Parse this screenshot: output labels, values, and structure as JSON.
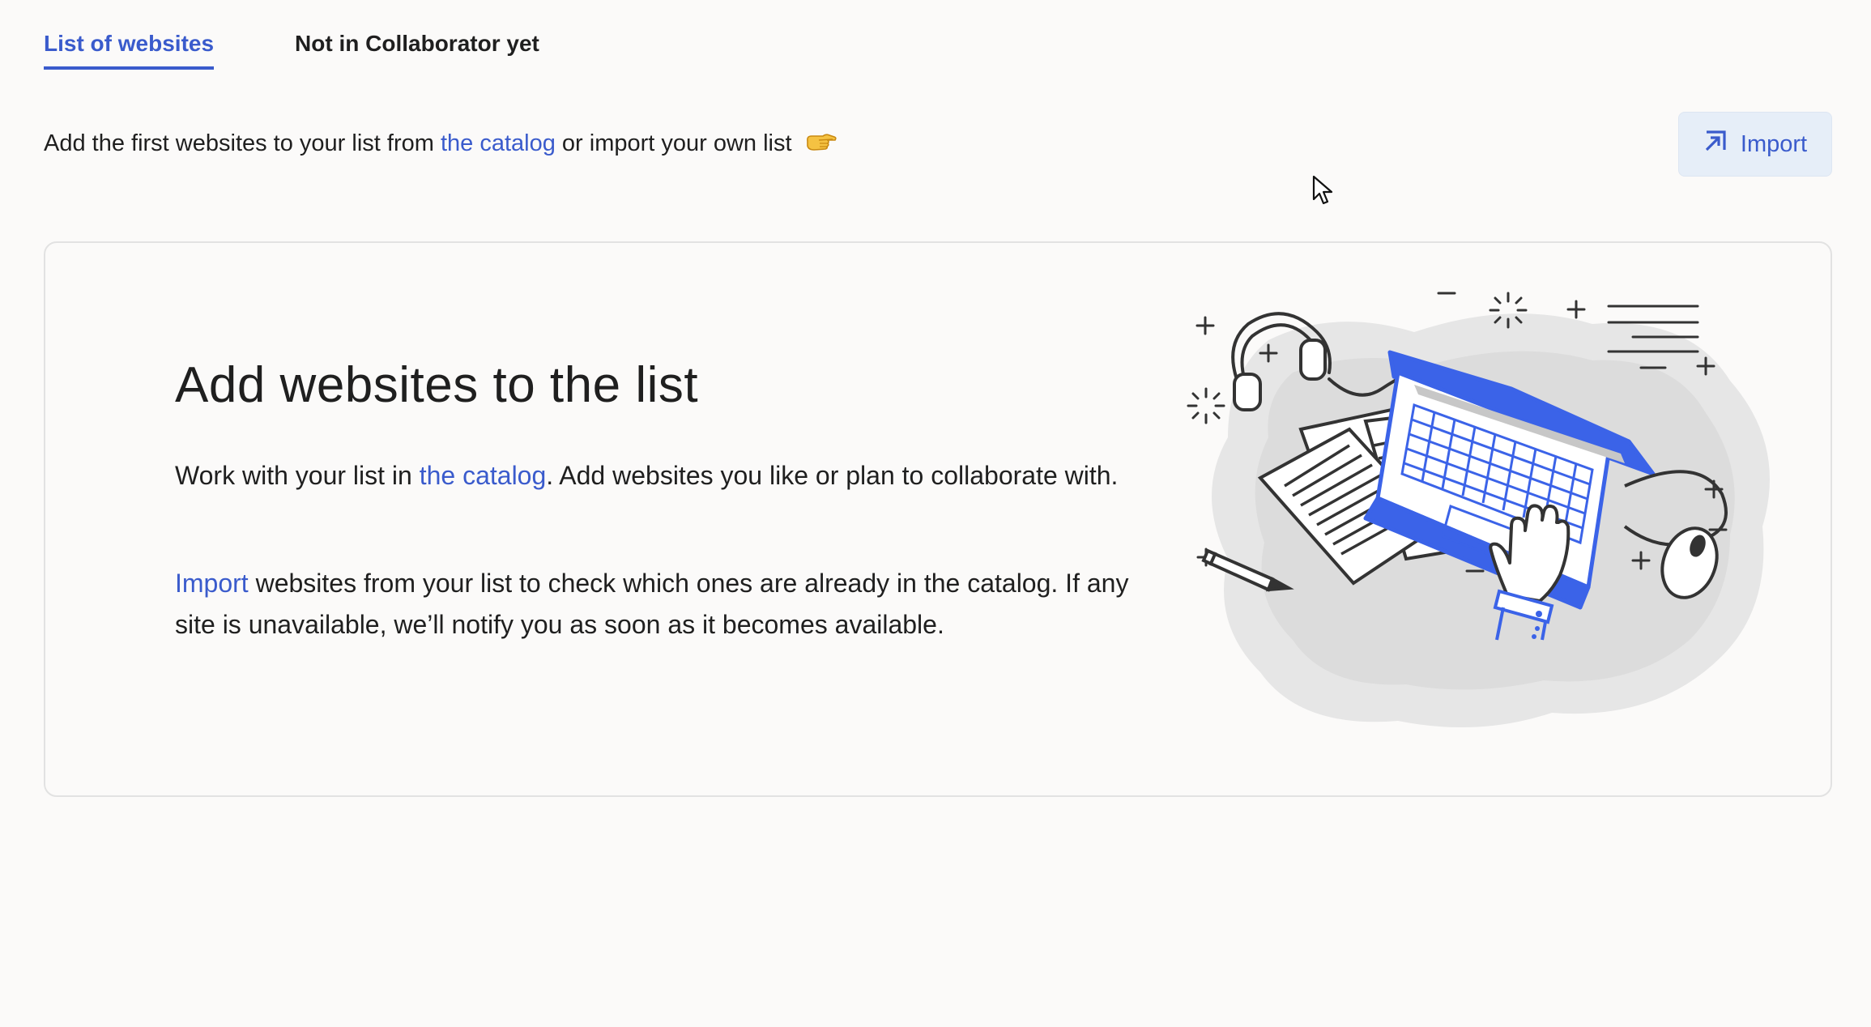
{
  "tabs": [
    {
      "label": "List of websites",
      "active": true
    },
    {
      "label": "Not in Collaborator yet",
      "active": false
    }
  ],
  "intro": {
    "before_link": "Add the first websites to your list from ",
    "link": "the catalog",
    "after_link": " or import your own list"
  },
  "import_button": {
    "label": "Import",
    "icon": "import-arrow-icon"
  },
  "card": {
    "title": "Add websites to the list",
    "para1": {
      "before_link": "Work with your list in ",
      "link": "the catalog",
      "after_link": ". Add websites you like or plan to collaborate with."
    },
    "para2": {
      "link": "Import",
      "after_link": " websites from your list to check which ones are already in the catalog. If any site is unavailable, we’ll notify you as soon as it becomes available."
    }
  },
  "colors": {
    "accent": "#3a5bcc",
    "button_bg": "#e6eef8",
    "background": "#fbfaf9",
    "illustration_blue": "#3b63e8"
  }
}
